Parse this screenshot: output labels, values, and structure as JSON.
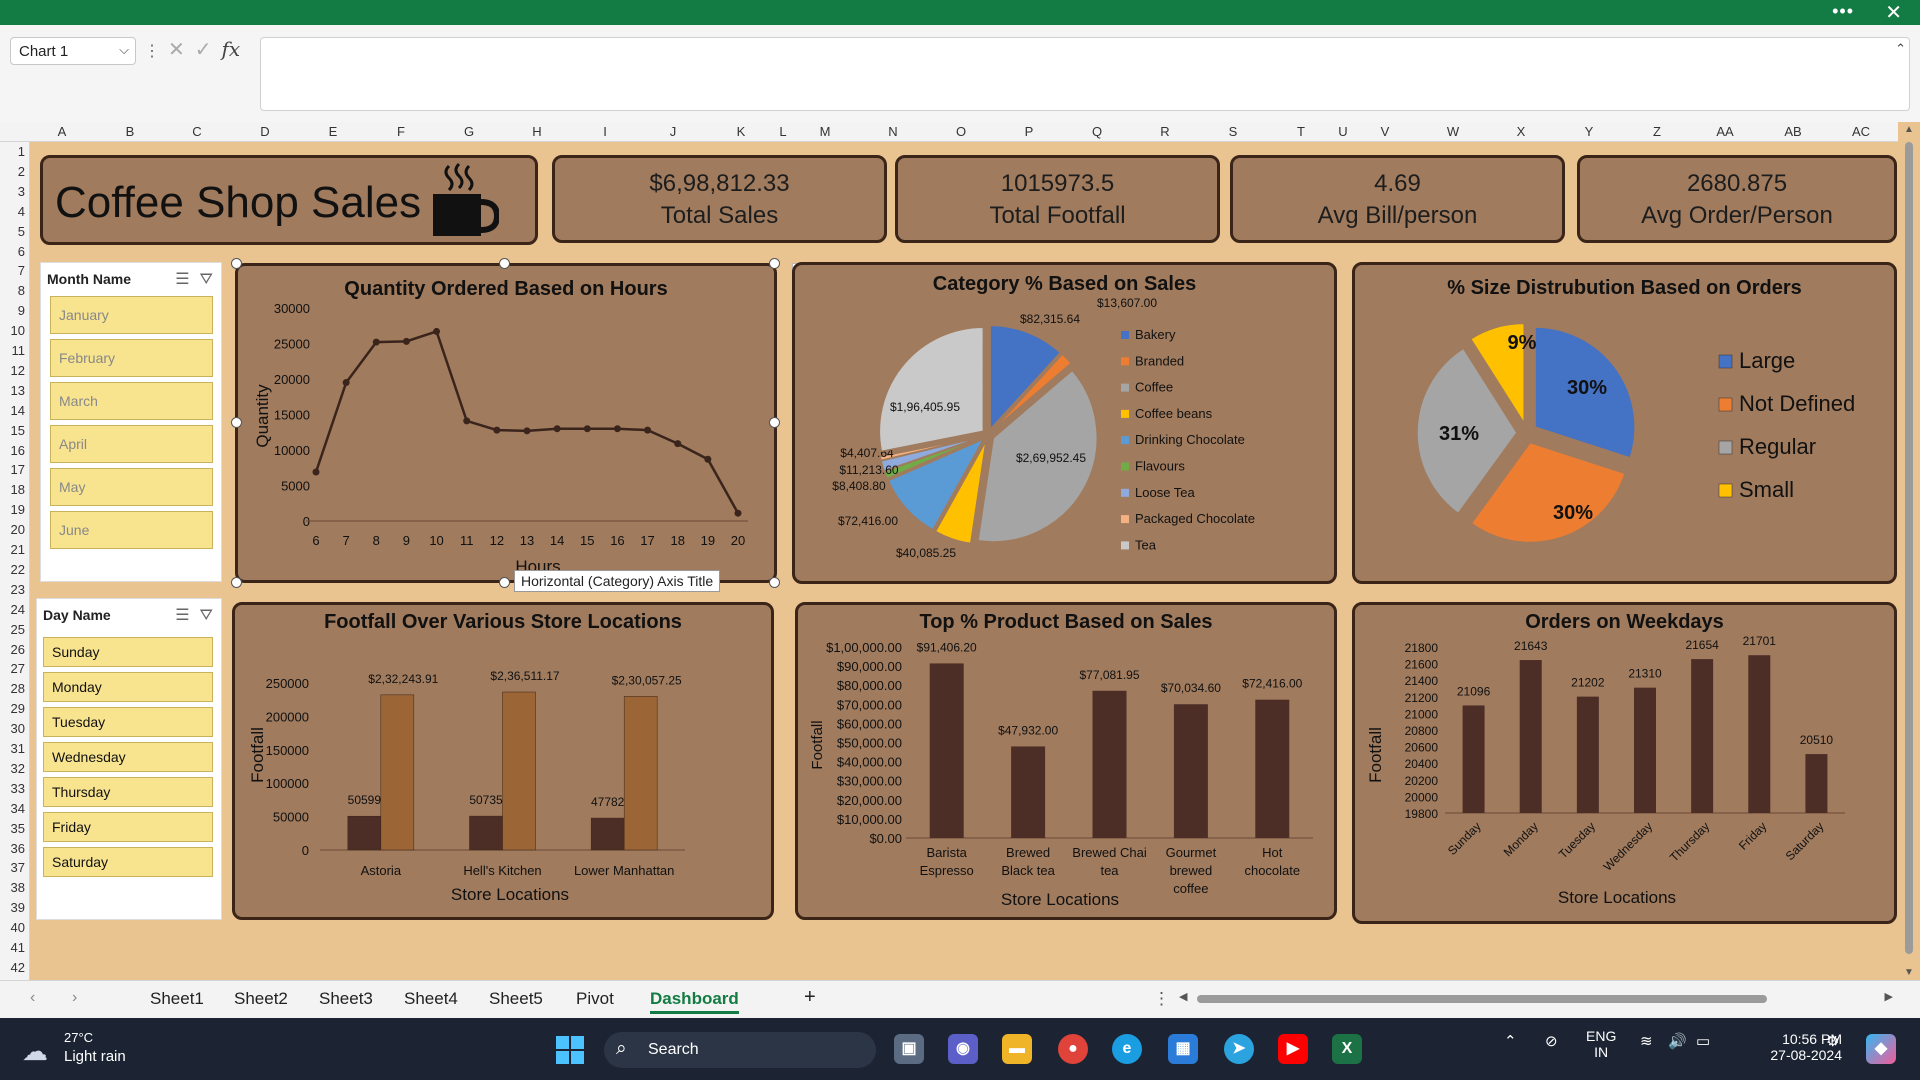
{
  "window": {
    "more_glyph": "•••",
    "close_glyph": "✕"
  },
  "formula_bar": {
    "name_box": "Chart 1",
    "formula": ""
  },
  "columns": [
    "A",
    "B",
    "C",
    "D",
    "E",
    "F",
    "G",
    "H",
    "I",
    "J",
    "K",
    "L",
    "M",
    "N",
    "O",
    "P",
    "Q",
    "R",
    "S",
    "T",
    "U",
    "V",
    "W",
    "X",
    "Y",
    "Z",
    "AA",
    "AB",
    "AC"
  ],
  "rows": [
    "1",
    "2",
    "3",
    "4",
    "5",
    "6",
    "7",
    "8",
    "9",
    "10",
    "11",
    "12",
    "13",
    "14",
    "15",
    "16",
    "17",
    "18",
    "19",
    "20",
    "21",
    "22",
    "23",
    "24",
    "25",
    "26",
    "27",
    "28",
    "29",
    "30",
    "31",
    "32",
    "33",
    "34",
    "35",
    "36",
    "37",
    "38",
    "39",
    "40",
    "41",
    "42"
  ],
  "dashboard": {
    "title": "Coffee Shop Sales",
    "cup_icon": "coffee-cup-icon",
    "kpis": [
      {
        "value": "$6,98,812.33",
        "label": "Total Sales"
      },
      {
        "value": "1015973.5",
        "label": "Total Footfall"
      },
      {
        "value": "4.69",
        "label": "Avg Bill/person"
      },
      {
        "value": "2680.875",
        "label": "Avg Order/Person"
      }
    ]
  },
  "slicers": {
    "month": {
      "header": "Month Name",
      "items": [
        "January",
        "February",
        "March",
        "April",
        "May",
        "June"
      ]
    },
    "day": {
      "header": "Day Name",
      "items": [
        "Sunday",
        "Monday",
        "Tuesday",
        "Wednesday",
        "Thursday",
        "Friday",
        "Saturday"
      ]
    }
  },
  "tooltip": "Horizontal (Category) Axis Title",
  "colors": {
    "bar_dark": "#4d2e26",
    "bar_brown": "#9b6535",
    "pie_large": "#4472c4",
    "pie_notdefined": "#ed7d31",
    "pie_regular": "#a5a5a5",
    "pie_small": "#ffc000"
  },
  "chart_data": [
    {
      "id": "hours",
      "type": "line",
      "title": "Quantity Ordered Based on Hours",
      "xlabel": "Hours",
      "ylabel": "Quantity",
      "categories": [
        "6",
        "7",
        "8",
        "9",
        "10",
        "11",
        "12",
        "13",
        "14",
        "15",
        "16",
        "17",
        "18",
        "19",
        "20"
      ],
      "values": [
        6900,
        19500,
        25200,
        25300,
        26700,
        14100,
        12800,
        12700,
        13000,
        13000,
        13000,
        12800,
        10900,
        8700,
        1100
      ],
      "yticks": [
        "30000",
        "25000",
        "20000",
        "15000",
        "10000",
        "5000",
        "0"
      ],
      "ylim": [
        0,
        30000
      ],
      "grid": false
    },
    {
      "id": "category",
      "type": "pie",
      "title": "Category % Based on Sales",
      "categories": [
        "Bakery",
        "Branded",
        "Coffee",
        "Coffee beans",
        "Drinking Chocolate",
        "Flavours",
        "Loose Tea",
        "Packaged Chocolate",
        "Tea"
      ],
      "values": [
        82315.64,
        13607.0,
        269952.45,
        40085.25,
        72416.0,
        8408.8,
        11213.6,
        4407.64,
        196405.95
      ],
      "labels": [
        "$82,315.64",
        "$13,607.00",
        "$2,69,952.45",
        "$40,085.25",
        "$72,416.00",
        "$8,408.80",
        "$11,213.60",
        "$4,407.64",
        "$1,96,405.95"
      ],
      "colors": [
        "#4472c4",
        "#ed7d31",
        "#a5a5a5",
        "#ffc000",
        "#5b9bd5",
        "#70ad47",
        "#8faadc",
        "#f4b183",
        "#c9c9c9"
      ]
    },
    {
      "id": "size",
      "type": "pie",
      "title": "% Size Distrubution  Based on Orders",
      "categories": [
        "Large",
        "Not Defined",
        "Regular",
        "Small"
      ],
      "values": [
        30,
        30,
        31,
        9
      ],
      "labels": [
        "30%",
        "30%",
        "31%",
        "9%"
      ],
      "colors": [
        "#4472c4",
        "#ed7d31",
        "#a5a5a5",
        "#ffc000"
      ],
      "legend": "right"
    },
    {
      "id": "footfall",
      "type": "bar",
      "title": "Footfall Over Various Store Locations",
      "xlabel": "Store Locations",
      "ylabel": "Footfall",
      "categories": [
        "Astoria",
        "Hell's Kitchen",
        "Lower Manhattan"
      ],
      "series": [
        {
          "values": [
            50599,
            50735,
            47782
          ],
          "labels": [
            "50599",
            "50735",
            "47782"
          ]
        },
        {
          "values": [
            232243.91,
            236511.17,
            230057.25
          ],
          "labels": [
            "$2,32,243.91",
            "$2,36,511.17",
            "$2,30,057.25"
          ]
        }
      ],
      "yticks": [
        "250000",
        "200000",
        "150000",
        "100000",
        "50000",
        "0"
      ],
      "ylim": [
        0,
        250000
      ]
    },
    {
      "id": "product",
      "type": "bar",
      "title": "Top % Product Based on Sales",
      "xlabel": "Store Locations",
      "ylabel": "Footfall",
      "categories": [
        [
          "Barista",
          "Espresso"
        ],
        [
          "Brewed",
          "Black tea"
        ],
        [
          "Brewed Chai",
          "tea"
        ],
        [
          "Gourmet",
          "brewed",
          "coffee"
        ],
        [
          "Hot",
          "chocolate"
        ]
      ],
      "values": [
        91406.2,
        47932.0,
        77081.95,
        70034.6,
        72416.0
      ],
      "labels": [
        "$91,406.20",
        "$47,932.00",
        "$77,081.95",
        "$70,034.60",
        "$72,416.00"
      ],
      "yticks": [
        "$1,00,000.00",
        "$90,000.00",
        "$80,000.00",
        "$70,000.00",
        "$60,000.00",
        "$50,000.00",
        "$40,000.00",
        "$30,000.00",
        "$20,000.00",
        "$10,000.00",
        "$0.00"
      ],
      "ylim": [
        0,
        100000
      ]
    },
    {
      "id": "weekday",
      "type": "bar",
      "title": "Orders on Weekdays",
      "xlabel": "Store Locations",
      "ylabel": "Footfall",
      "categories": [
        "Sunday",
        "Monday",
        "Tuesday",
        "Wednesday",
        "Thursday",
        "Friday",
        "Saturday"
      ],
      "values": [
        21096,
        21643,
        21202,
        21310,
        21654,
        21701,
        20510
      ],
      "labels": [
        "21096",
        "21643",
        "21202",
        "21310",
        "21654",
        "21701",
        "20510"
      ],
      "yticks": [
        "21800",
        "21600",
        "21400",
        "21200",
        "21000",
        "20800",
        "20600",
        "20400",
        "20200",
        "20000",
        "19800"
      ],
      "ylim": [
        19800,
        21800
      ]
    }
  ],
  "sheet_tabs": [
    "Sheet1",
    "Sheet2",
    "Sheet3",
    "Sheet4",
    "Sheet5",
    "Pivot",
    "Dashboard"
  ],
  "active_tab": "Dashboard",
  "add_sheet_glyph": "+",
  "taskbar": {
    "weather_temp": "27°C",
    "weather_cond": "Light rain",
    "search_label": "Search",
    "lang": "ENG",
    "region": "IN",
    "time": "10:56 PM",
    "date": "27-08-2024"
  }
}
